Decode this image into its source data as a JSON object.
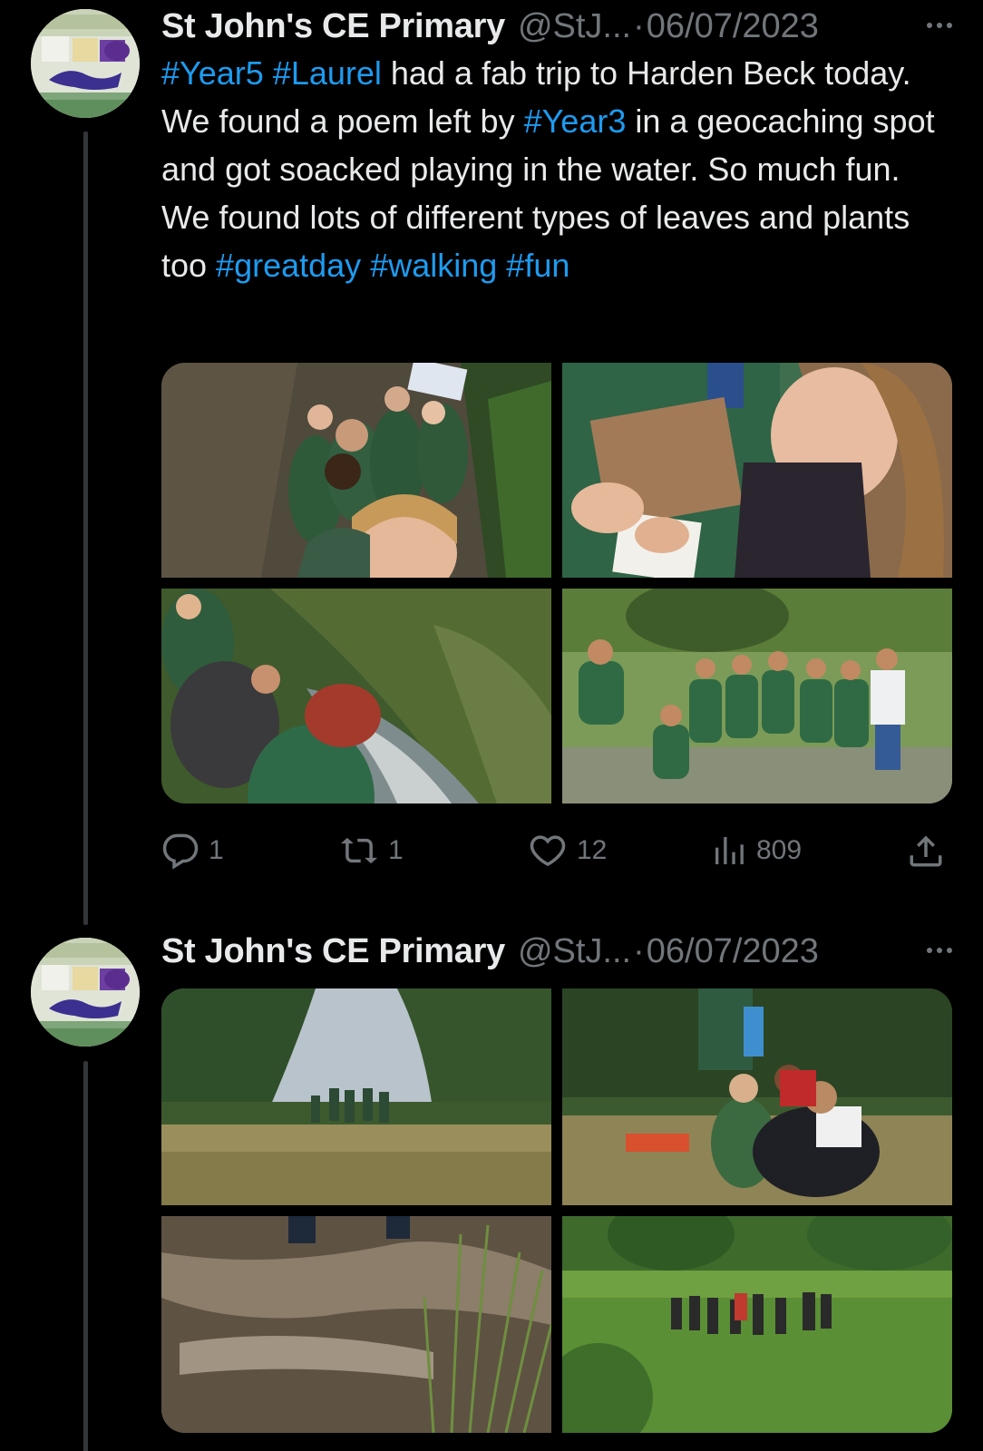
{
  "tweets": [
    {
      "name": "St John's CE Primary",
      "handle": "@StJ...",
      "separator": "·",
      "date": "06/07/2023",
      "text_parts": [
        {
          "t": "#Year5",
          "tag": true
        },
        {
          "t": " ",
          "tag": false
        },
        {
          "t": "#Laurel",
          "tag": true
        },
        {
          "t": " had a fab trip to Harden Beck today. We found a poem left by ",
          "tag": false
        },
        {
          "t": "#Year3",
          "tag": true
        },
        {
          "t": " in a geocaching spot and got soacked playing in the water. So much fun. We found lots of different types of leaves and plants too ",
          "tag": false
        },
        {
          "t": "#greatday",
          "tag": true
        },
        {
          "t": " ",
          "tag": false
        },
        {
          "t": "#walking",
          "tag": true
        },
        {
          "t": " ",
          "tag": false
        },
        {
          "t": "#fun",
          "tag": true
        }
      ],
      "photos": [
        "group selfie on woodland path",
        "child reading clipboard",
        "children by rocky stream",
        "group standing in stream"
      ],
      "stats": {
        "replies": "1",
        "reposts": "1",
        "likes": "12",
        "views": "809"
      }
    },
    {
      "name": "St John's CE Primary",
      "handle": "@StJ...",
      "separator": "·",
      "date": "06/07/2023",
      "photos": [
        "group in long grass field",
        "children writing in meadow",
        "water splashing in stream",
        "group walking through meadow"
      ]
    }
  ],
  "icons": {
    "reply": "reply-icon",
    "repost": "repost-icon",
    "like": "heart-icon",
    "views": "views-icon",
    "share": "share-icon",
    "more": "more-icon"
  },
  "colors": {
    "background": "#000000",
    "text": "#e7e9ea",
    "muted": "#71767b",
    "link": "#1d9bf0"
  }
}
